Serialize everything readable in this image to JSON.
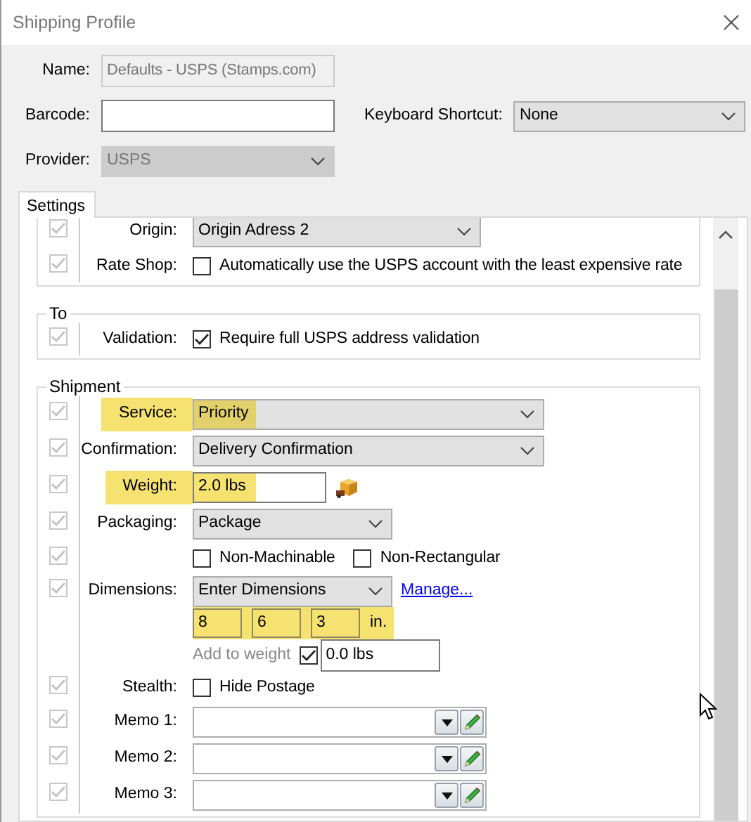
{
  "window": {
    "title": "Shipping Profile"
  },
  "header": {
    "name": {
      "label": "Name:",
      "value": "Defaults - USPS (Stamps.com)",
      "disabled": true
    },
    "barcode": {
      "label": "Barcode:"
    },
    "shortcut": {
      "label": "Keyboard Shortcut:",
      "value": "None"
    },
    "provider": {
      "label": "Provider:",
      "value": "USPS",
      "disabled": true
    }
  },
  "tabs": [
    {
      "label": "Settings",
      "selected": true
    }
  ],
  "groups": [
    {
      "rows": [
        {
          "kind": "medium-select",
          "label": "Origin:",
          "value": "Origin Adress 2",
          "row_checked": true,
          "highlighted": false
        },
        {
          "kind": "check",
          "label": "Rate Shop:",
          "row_checked": true,
          "options": [
            {
              "text": "Automatically use the USPS account with the least expensive rate",
              "checked": false
            }
          ]
        }
      ]
    },
    {
      "title": "To",
      "rows": [
        {
          "kind": "check",
          "label": "Validation:",
          "row_checked": true,
          "options": [
            {
              "text": "Require full USPS address validation",
              "checked": true
            }
          ]
        }
      ]
    },
    {
      "title": "Shipment",
      "rows": [
        {
          "kind": "select",
          "label": "Service:",
          "value": "Priority",
          "row_checked": true,
          "highlighted": true
        },
        {
          "kind": "select",
          "label": "Confirmation:",
          "value": "Delivery Confirmation",
          "row_checked": true,
          "highlighted": false
        },
        {
          "kind": "weight",
          "label": "Weight:",
          "value": "2.0 lbs",
          "row_checked": true,
          "highlighted": true
        },
        {
          "kind": "short-select",
          "label": "Packaging:",
          "value": "Package",
          "row_checked": true,
          "highlighted": false
        },
        {
          "kind": "check",
          "row_checked": true,
          "options": [
            {
              "text": "Non-Machinable",
              "checked": false
            },
            {
              "text": "Non-Rectangular",
              "checked": false
            }
          ]
        },
        {
          "kind": "short-select",
          "label": "Dimensions:",
          "value": "Enter Dimensions",
          "link": "Manage...",
          "row_checked": true,
          "highlighted": false
        },
        {
          "kind": "dims",
          "values": [
            "8",
            "6",
            "3"
          ],
          "unit": "in.",
          "highlighted": true
        },
        {
          "kind": "add-weight",
          "text": "Add to weight",
          "checked": true,
          "value": "0.0 lbs"
        },
        {
          "kind": "check",
          "label": "Stealth:",
          "row_checked": true,
          "options": [
            {
              "text": "Hide Postage",
              "checked": false
            }
          ]
        },
        {
          "kind": "memo",
          "label": "Memo 1:",
          "row_checked": true
        },
        {
          "kind": "memo",
          "label": "Memo 2:",
          "row_checked": true
        },
        {
          "kind": "memo",
          "label": "Memo 3:",
          "row_checked": true
        }
      ]
    }
  ]
}
